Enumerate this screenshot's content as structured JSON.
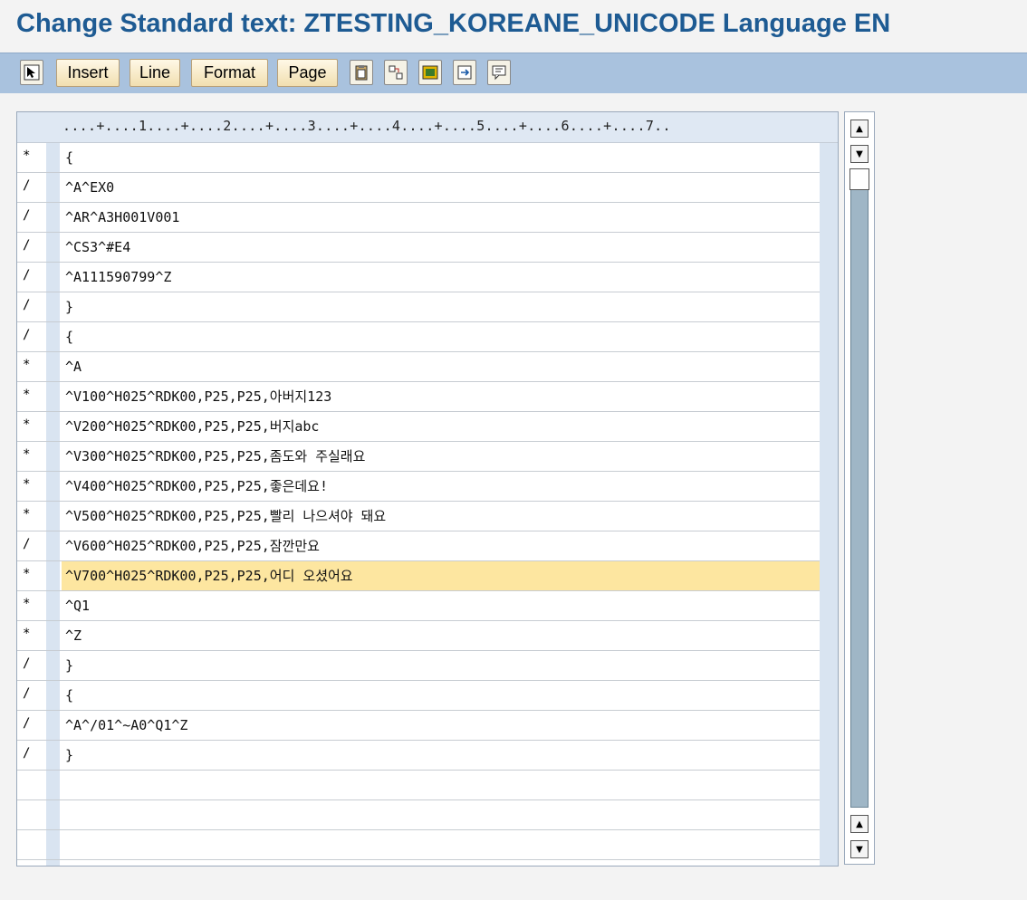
{
  "window": {
    "title": "Change Standard text: ZTESTING_KOREANE_UNICODE Language EN"
  },
  "toolbar": {
    "buttons": [
      {
        "label": "Insert"
      },
      {
        "label": "Line"
      },
      {
        "label": "Format"
      },
      {
        "label": "Page"
      }
    ],
    "icons": [
      "select-cursor-icon",
      "paste-icon",
      "split-icon",
      "graphic-icon",
      "move-icon",
      "comment-icon"
    ]
  },
  "editor": {
    "ruler": "....+....1....+....2....+....3....+....4....+....5....+....6....+....7..",
    "selected_line": 14,
    "lines": [
      {
        "format": "*",
        "text": "{"
      },
      {
        "format": "/",
        "text": "^A^EX0"
      },
      {
        "format": "/",
        "text": "^AR^A3H001V001"
      },
      {
        "format": "/",
        "text": "^CS3^#E4"
      },
      {
        "format": "/",
        "text": "^A111590799^Z"
      },
      {
        "format": "/",
        "text": "}"
      },
      {
        "format": "/",
        "text": "{"
      },
      {
        "format": "*",
        "text": "^A"
      },
      {
        "format": "*",
        "text": "^V100^H025^RDK00,P25,P25,아버지123"
      },
      {
        "format": "*",
        "text": "^V200^H025^RDK00,P25,P25,버지abc"
      },
      {
        "format": "*",
        "text": "^V300^H025^RDK00,P25,P25,좀도와 주실래요"
      },
      {
        "format": "*",
        "text": "^V400^H025^RDK00,P25,P25,좋은데요!"
      },
      {
        "format": "*",
        "text": "^V500^H025^RDK00,P25,P25,빨리 나으셔야 돼요"
      },
      {
        "format": "/",
        "text": "^V600^H025^RDK00,P25,P25,잠깐만요"
      },
      {
        "format": "*",
        "text": "^V700^H025^RDK00,P25,P25,어디 오셨어요"
      },
      {
        "format": "*",
        "text": "^Q1"
      },
      {
        "format": "*",
        "text": "^Z"
      },
      {
        "format": "/",
        "text": "}"
      },
      {
        "format": "/",
        "text": "{"
      },
      {
        "format": "/",
        "text": "^A^/01^~A0^Q1^Z"
      },
      {
        "format": "/",
        "text": "}"
      },
      {
        "format": "",
        "text": ""
      },
      {
        "format": "",
        "text": ""
      },
      {
        "format": "",
        "text": ""
      }
    ]
  },
  "colors": {
    "title": "#1e5b93",
    "toolbar_bg": "#a9c2de",
    "selected_line": "#fde6a0"
  }
}
